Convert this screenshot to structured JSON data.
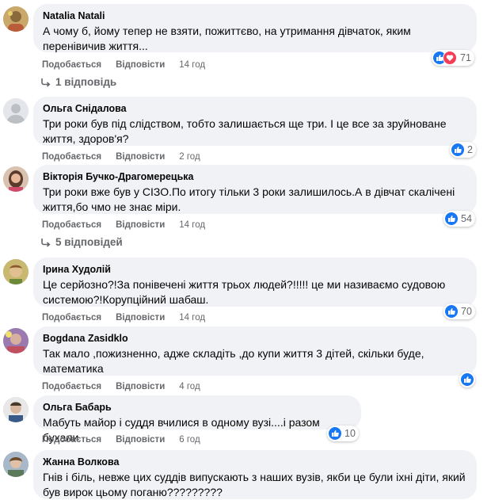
{
  "actions": {
    "like": "Подобається",
    "reply": "Відповісти"
  },
  "comments": [
    {
      "name": "Natalia Natali",
      "lines": [
        "А чому б, йому тепер не взяти, пожиттєво, на утримання дівчаток, яким",
        "перенівичив життя..."
      ],
      "time": "14 год",
      "reactions": "71",
      "replies": "1 відповідь"
    },
    {
      "name": "Ольга Снідалова",
      "lines": [
        "Три роки був під слідством, тобто залишається ще три. І це все за зруйноване",
        "життя, здоров'я?"
      ],
      "time": "2 год",
      "reactions": "2"
    },
    {
      "name": "Вікторія Бучко-Драгомерецька",
      "lines": [
        "Три роки вже був у СІЗО.По итогу тільки 3 роки залишилось.А в дівчат скалічені",
        "життя,бо чмо не знає міри."
      ],
      "time": "14 год",
      "reactions": "54",
      "replies": "5 відповідей"
    },
    {
      "name": "Ірина Худолій",
      "lines": [
        "Це серйозно?!За понівечені життя трьох людей?!!!!! це ми називаємо судовою",
        "системою?!Корупційний шабаш."
      ],
      "time": "14 год",
      "reactions": "70"
    },
    {
      "name": "Bogdana Zasidklo",
      "lines": [
        "Так мало ,пожизненно, адже складіть ,до купи життя 3 дітей, скільки буде,",
        "математика"
      ],
      "time": "4 год",
      "reactions": ""
    },
    {
      "name": "Ольга Бабарь",
      "lines": [
        "Мабуть майор і суддя вчилися в одному вузі....і разом бухали"
      ],
      "time": "6 год",
      "reactions": "10"
    },
    {
      "name": "Жанна Волкова",
      "lines": [
        "Гнів і біль, невже цих суддів випускають з наших вузів, якби це були іхні діти, який",
        "був вирок цьому поганю?????????"
      ]
    }
  ]
}
